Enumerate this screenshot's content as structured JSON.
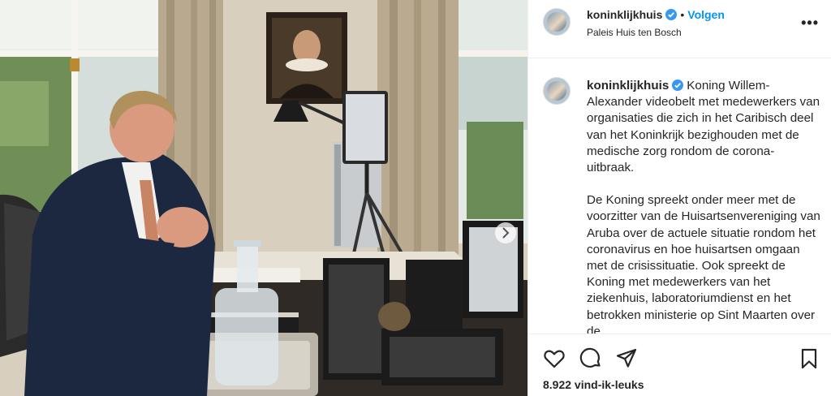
{
  "post": {
    "username": "koninklijkhuis",
    "follow_label": "Volgen",
    "separator": "•",
    "location": "Paleis Huis ten Bosch",
    "more_label": "•••",
    "caption_paragraphs": [
      "Koning Willem-Alexander videobelt met medewerkers van organisaties die zich in het Caribisch deel van het Koninkrijk bezighouden met de medische zorg rondom de corona-uitbraak.",
      "De Koning spreekt onder meer met de voorzitter van de Huisartsenvereniging van Aruba over de actuele situatie rondom het coronavirus en hoe huisartsen omgaan met de crisissituatie. Ook spreekt de Koning met medewerkers van het ziekenhuis, laboratoriumdienst en het betrokken ministerie op Sint Maarten over de"
    ],
    "likes": "8.922 vind-ik-leuks"
  },
  "icons": {
    "verified": "verified-badge-icon",
    "like": "heart-icon",
    "comment": "comment-icon",
    "share": "send-icon",
    "save": "bookmark-icon",
    "more": "more-options-icon",
    "carousel": "chevron-right-icon"
  },
  "colors": {
    "link_blue": "#0095f6",
    "verified_blue": "#3897f0",
    "text": "#262626",
    "border": "#efefef"
  }
}
